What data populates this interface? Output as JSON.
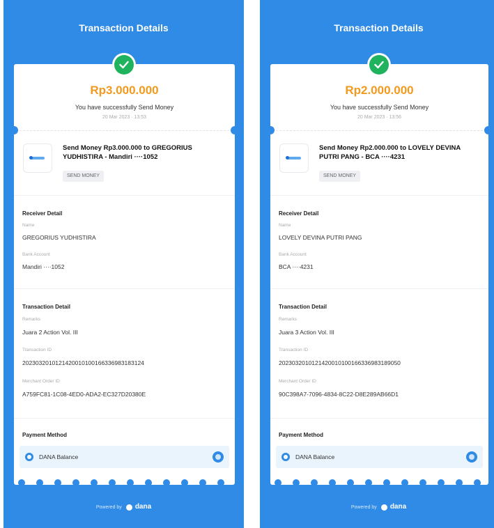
{
  "screens": [
    {
      "title": "Transaction Details",
      "amount": "Rp3.000.000",
      "status_text": "You have successfully Send Money",
      "datetime": "20 Mar 2023 · 13:53",
      "headline": "Send Money Rp3.000.000 to GREGORIUS YUDHISTIRA - Mandiri ····1052",
      "category_chip": "SEND MONEY",
      "receiver": {
        "section_title": "Receiver Detail",
        "name_label": "Name",
        "name_value": "GREGORIUS YUDHISTIRA",
        "account_label": "Bank Account",
        "account_value": "Mandiri ····1052"
      },
      "transaction": {
        "section_title": "Transaction Detail",
        "remarks_label": "Remarks",
        "remarks_value": "Juara 2 Action Vol. III",
        "txid_label": "Transaction ID",
        "txid_value": "2023032010121420010100166336983183124",
        "order_label": "Merchant Order ID",
        "order_value": "A759FC81-1C08-4ED0-ADA2-EC327D20380E"
      },
      "payment": {
        "section_title": "Payment Method",
        "method": "DANA Balance",
        "method_icon": "dana-wallet-icon"
      },
      "footer": {
        "powered_by": "Powered by",
        "brand": "dana"
      }
    },
    {
      "title": "Transaction Details",
      "amount": "Rp2.000.000",
      "status_text": "You have successfully Send Money",
      "datetime": "20 Mar 2023 · 13:56",
      "headline": "Send Money Rp2.000.000 to LOVELY DEVINA PUTRI PANG - BCA ····4231",
      "category_chip": "SEND MONEY",
      "receiver": {
        "section_title": "Receiver Detail",
        "name_label": "Name",
        "name_value": "LOVELY DEVINA PUTRI PANG",
        "account_label": "Bank Account",
        "account_value": "BCA ····4231"
      },
      "transaction": {
        "section_title": "Transaction Detail",
        "remarks_label": "Remarks",
        "remarks_value": "Juara 3 Action Vol. III",
        "txid_label": "Transaction ID",
        "txid_value": "2023032010121420010100166336983189050",
        "order_label": "Merchant Order ID",
        "order_value": "90C398A7-7096-4834-8C22-D8E289AB66D1"
      },
      "payment": {
        "section_title": "Payment Method",
        "method": "DANA Balance",
        "method_icon": "dana-wallet-icon"
      },
      "footer": {
        "powered_by": "Powered by",
        "brand": "dana"
      }
    }
  ],
  "colors": {
    "brand_blue": "#2f8be6",
    "amount_orange": "#f29a1e",
    "success_green": "#1fb35e"
  }
}
